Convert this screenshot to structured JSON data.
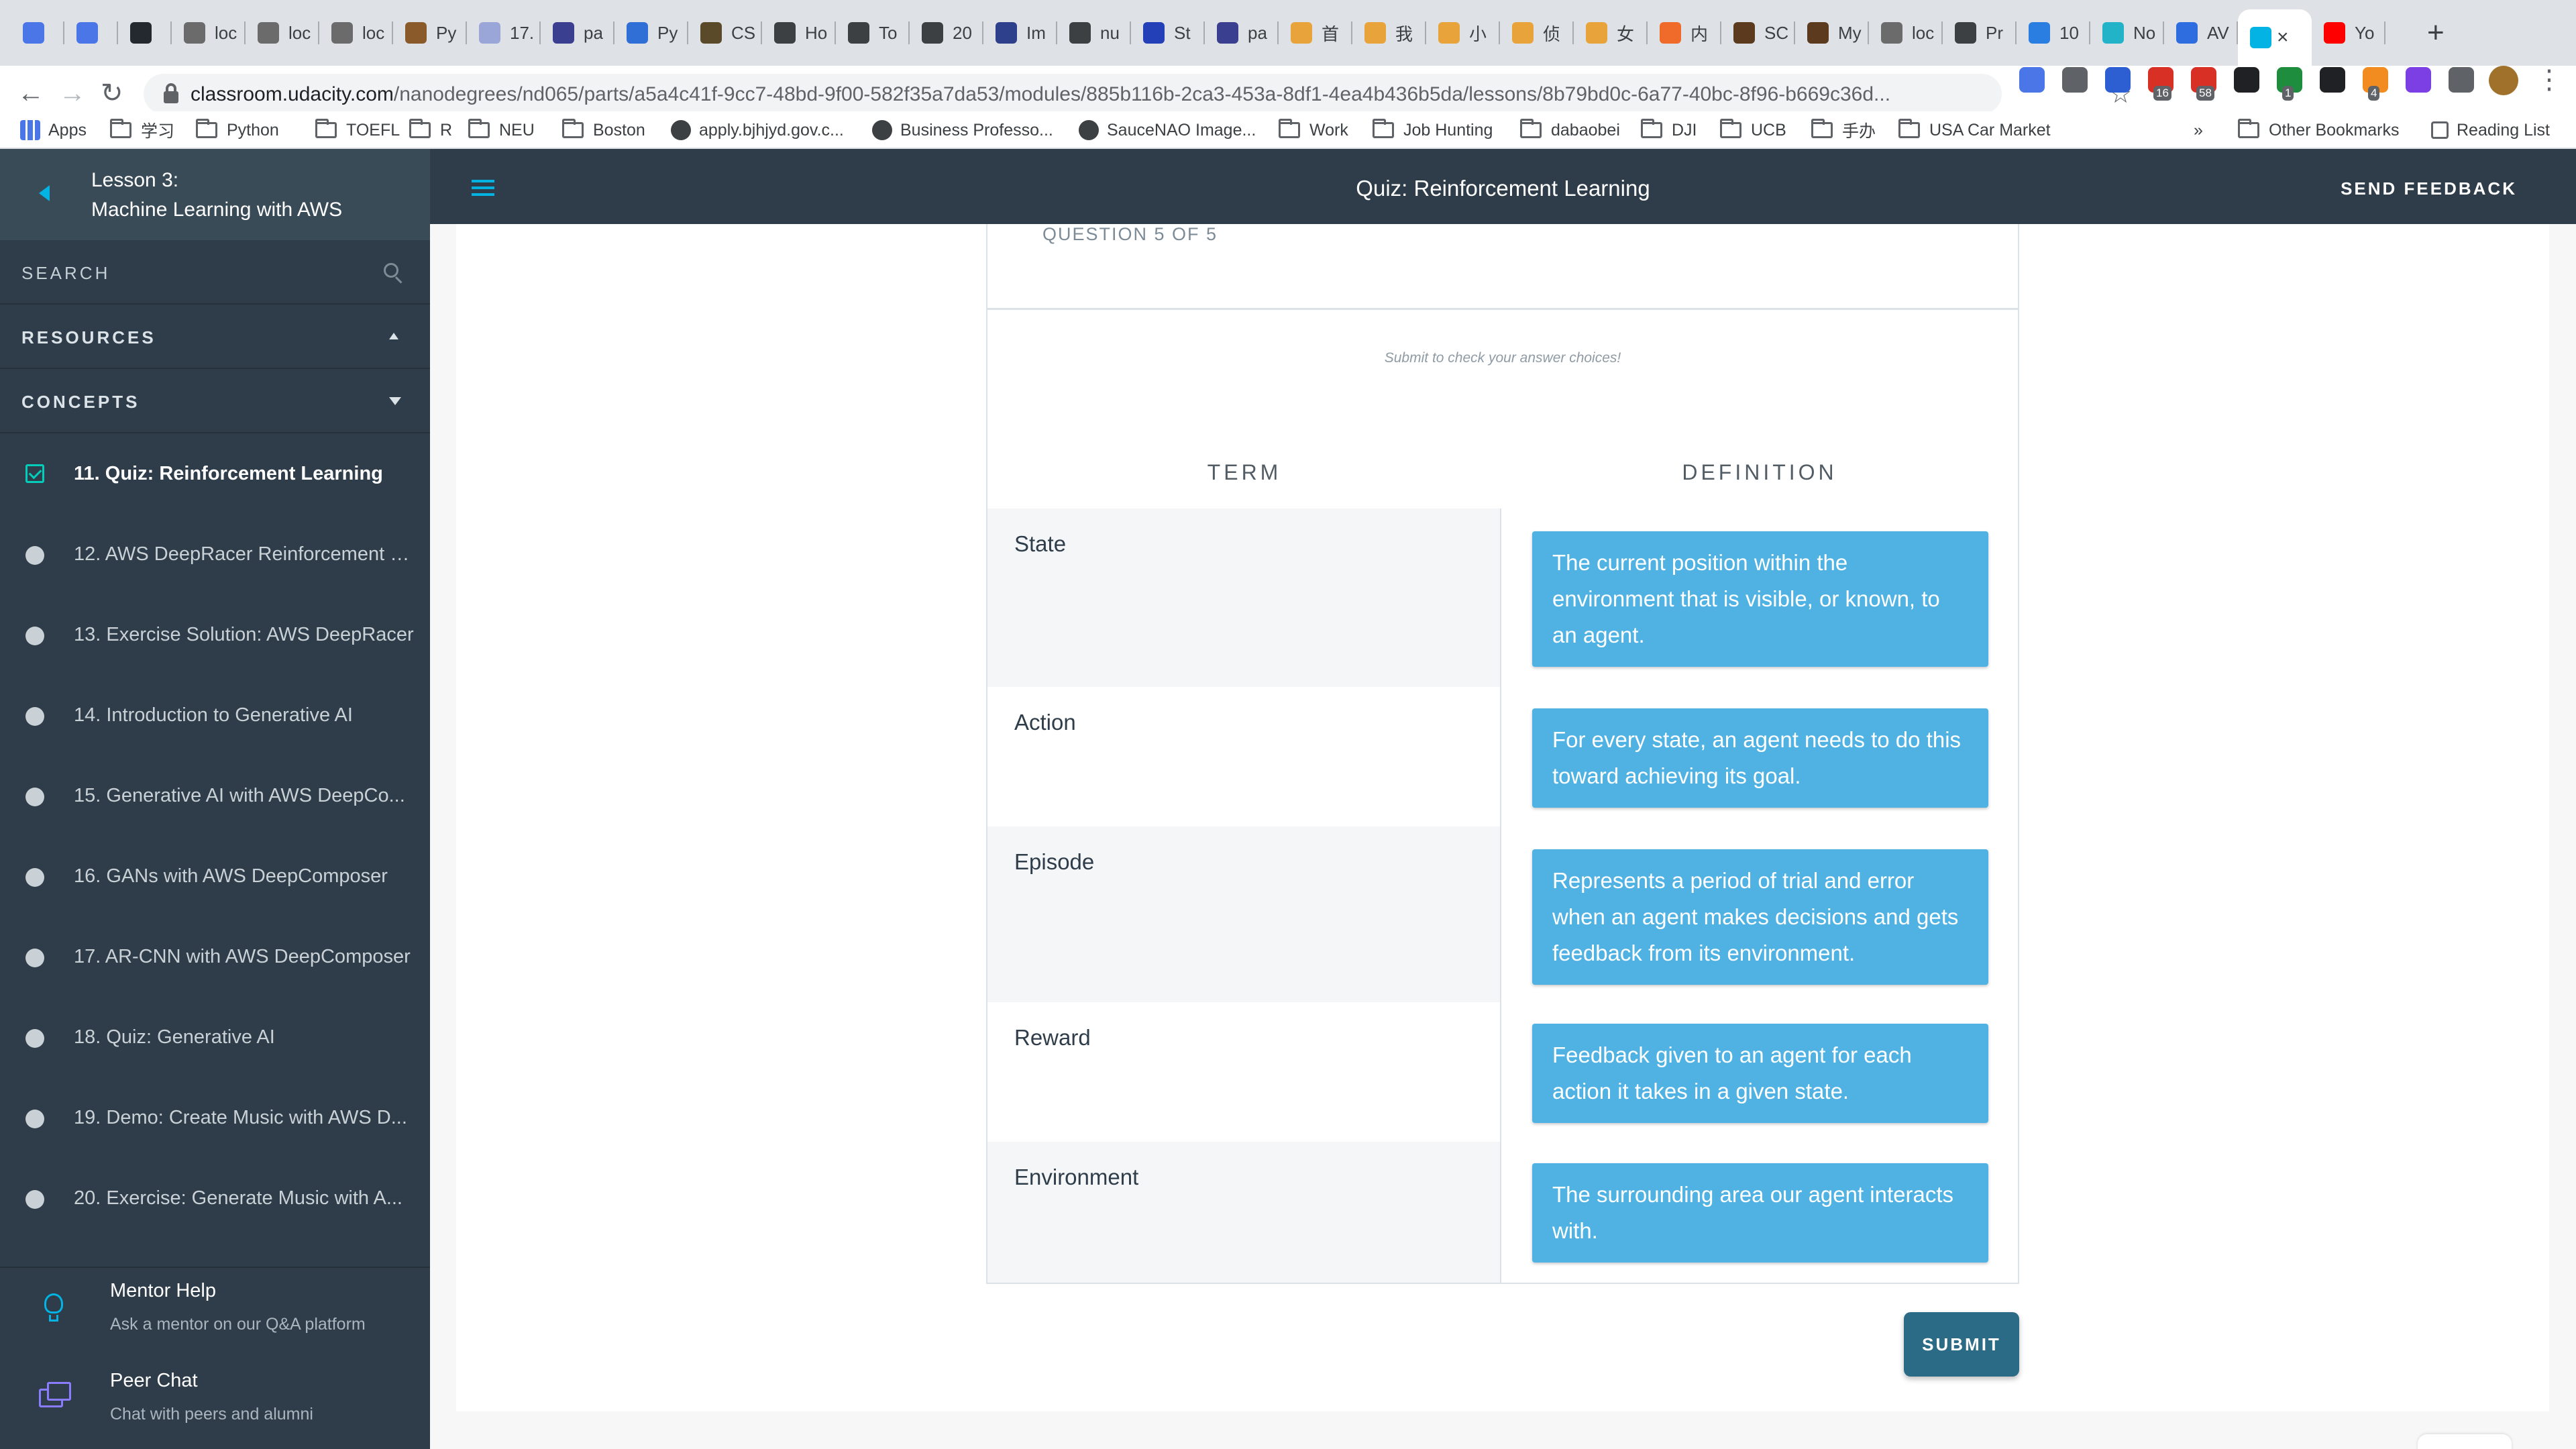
{
  "browser": {
    "tabs": [
      {
        "label": "",
        "icon_color": "#4a76e8"
      },
      {
        "label": "",
        "icon_color": "#4a76e8"
      },
      {
        "label": "",
        "icon_color": "#24292f"
      },
      {
        "label": "loc",
        "icon_color": "#6b6b6b"
      },
      {
        "label": "loc",
        "icon_color": "#6b6b6b"
      },
      {
        "label": "loc",
        "icon_color": "#6b6b6b"
      },
      {
        "label": "Py",
        "icon_color": "#8a5a2b"
      },
      {
        "label": "17.",
        "icon_color": "#9aa5d8"
      },
      {
        "label": "pa",
        "icon_color": "#3b3f8f"
      },
      {
        "label": "Py",
        "icon_color": "#2f6fd6"
      },
      {
        "label": "CS",
        "icon_color": "#5b4a2a"
      },
      {
        "label": "Ho",
        "icon_color": "#3c4043"
      },
      {
        "label": "To",
        "icon_color": "#3c4043"
      },
      {
        "label": "20",
        "icon_color": "#3c4043"
      },
      {
        "label": "Im",
        "icon_color": "#2e3f8c"
      },
      {
        "label": "nu",
        "icon_color": "#3c4043"
      },
      {
        "label": "St",
        "icon_color": "#2340b8"
      },
      {
        "label": "pa",
        "icon_color": "#3b3f8f"
      },
      {
        "label": "首",
        "icon_color": "#e8a33a"
      },
      {
        "label": "我",
        "icon_color": "#e8a33a"
      },
      {
        "label": "小",
        "icon_color": "#e8a33a"
      },
      {
        "label": "侦",
        "icon_color": "#e8a33a"
      },
      {
        "label": "女",
        "icon_color": "#e8a33a"
      },
      {
        "label": "内",
        "icon_color": "#f06a2a"
      },
      {
        "label": "SC",
        "icon_color": "#5b3a1e"
      },
      {
        "label": "My",
        "icon_color": "#5b3a1e"
      },
      {
        "label": "loc",
        "icon_color": "#6b6b6b"
      },
      {
        "label": "Pr",
        "icon_color": "#3c4043"
      },
      {
        "label": "10",
        "icon_color": "#2a7de1"
      },
      {
        "label": "No",
        "icon_color": "#22b3c9"
      },
      {
        "label": "AV",
        "icon_color": "#2d6de0"
      },
      {
        "label": "",
        "icon_color": "#02b3e4",
        "active": true
      },
      {
        "label": "Yo",
        "icon_color": "#ff0000"
      }
    ],
    "url_host": "classroom.udacity.com",
    "url_path": "/nanodegrees/nd065/parts/a5a4c41f-9cc7-48bd-9f00-582f35a7da53/modules/885b116b-2ca3-453a-8df1-4ea4b436b5da/lessons/8b79bd0c-6a77-40bc-8f96-b669c36d...",
    "extension_badges": [
      "16",
      "58",
      "1",
      "4"
    ],
    "bookmarks": [
      {
        "label": "Apps",
        "kind": "apps"
      },
      {
        "label": "学习",
        "kind": "folder"
      },
      {
        "label": "Python",
        "kind": "folder"
      },
      {
        "label": "TOEFL",
        "kind": "folder"
      },
      {
        "label": "R",
        "kind": "folder"
      },
      {
        "label": "NEU",
        "kind": "folder"
      },
      {
        "label": "Boston",
        "kind": "folder"
      },
      {
        "label": "apply.bjhjyd.gov.c...",
        "kind": "site"
      },
      {
        "label": "Business Professo...",
        "kind": "site"
      },
      {
        "label": "SauceNAO Image...",
        "kind": "site"
      },
      {
        "label": "Work",
        "kind": "folder"
      },
      {
        "label": "Job Hunting",
        "kind": "folder"
      },
      {
        "label": "dabaobei",
        "kind": "folder"
      },
      {
        "label": "DJI",
        "kind": "folder"
      },
      {
        "label": "UCB",
        "kind": "folder"
      },
      {
        "label": "手办",
        "kind": "folder"
      },
      {
        "label": "USA Car Market",
        "kind": "folder"
      }
    ],
    "bookmarks_overflow": "»",
    "other_bookmarks": "Other Bookmarks",
    "reading_list": "Reading List"
  },
  "sidebar": {
    "lesson_number": "Lesson 3:",
    "lesson_title": "Machine Learning with AWS",
    "search_label": "SEARCH",
    "resources_label": "RESOURCES",
    "concepts_label": "CONCEPTS",
    "concepts": [
      {
        "label": "11. Quiz: Reinforcement Learning",
        "current": true
      },
      {
        "label": "12. AWS DeepRacer Reinforcement L...",
        "current": false
      },
      {
        "label": "13. Exercise Solution: AWS DeepRacer",
        "current": false
      },
      {
        "label": "14. Introduction to Generative AI",
        "current": false
      },
      {
        "label": "15. Generative AI with AWS DeepCo...",
        "current": false
      },
      {
        "label": "16. GANs with AWS DeepComposer",
        "current": false
      },
      {
        "label": "17. AR-CNN with AWS DeepComposer",
        "current": false
      },
      {
        "label": "18. Quiz: Generative AI",
        "current": false
      },
      {
        "label": "19. Demo: Create Music with AWS D...",
        "current": false
      },
      {
        "label": "20. Exercise: Generate Music with A...",
        "current": false
      }
    ],
    "mentor_title": "Mentor Help",
    "mentor_sub": "Ask a mentor on our Q&A platform",
    "peer_title": "Peer Chat",
    "peer_sub": "Chat with peers and alumni"
  },
  "header": {
    "title": "Quiz: Reinforcement Learning",
    "feedback": "SEND FEEDBACK"
  },
  "quiz": {
    "question_number": "QUESTION 5 OF 5",
    "hint": "Submit to check your answer choices!",
    "col_term": "TERM",
    "col_definition": "DEFINITION",
    "rows": [
      {
        "term": "State",
        "definition": "The current position within the environment that is visible, or known, to an agent."
      },
      {
        "term": "Action",
        "definition": "For every state, an agent needs to do this toward achieving its goal."
      },
      {
        "term": "Episode",
        "definition": "Represents a period of trial and error when an agent makes decisions and gets feedback from its environment."
      },
      {
        "term": "Reward",
        "definition": "Feedback given to an agent for each action it takes in a given state."
      },
      {
        "term": "Environment",
        "definition": "The surrounding area our agent interacts with."
      }
    ],
    "submit": "SUBMIT"
  },
  "colors": {
    "sidebar": "#2e3d49",
    "accent": "#02b3e4",
    "definition_card": "#4fb2e3",
    "submit": "#2b6b85"
  }
}
